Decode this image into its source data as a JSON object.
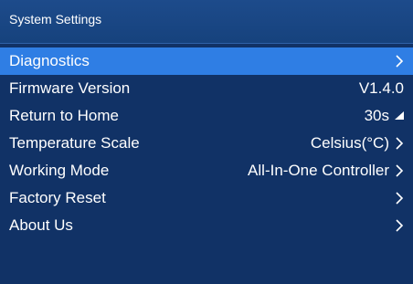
{
  "window": {
    "title": "System Settings"
  },
  "menu": {
    "items": [
      {
        "name": "diagnostics",
        "label": "Diagnostics",
        "value": "",
        "icon": "chevron-right-icon",
        "selected": true
      },
      {
        "name": "firmware-version",
        "label": "Firmware Version",
        "value": "V1.4.0",
        "icon": "",
        "selected": false
      },
      {
        "name": "return-to-home",
        "label": "Return to Home",
        "value": "30s",
        "icon": "triangle-corner-icon",
        "selected": false
      },
      {
        "name": "temperature-scale",
        "label": "Temperature Scale",
        "value": "Celsius(°C)",
        "icon": "chevron-right-icon",
        "selected": false
      },
      {
        "name": "working-mode",
        "label": "Working Mode",
        "value": "All-In-One Controller",
        "icon": "chevron-right-icon",
        "selected": false
      },
      {
        "name": "factory-reset",
        "label": "Factory Reset",
        "value": "",
        "icon": "chevron-right-icon",
        "selected": false
      },
      {
        "name": "about-us",
        "label": "About Us",
        "value": "",
        "icon": "chevron-right-icon",
        "selected": false
      }
    ]
  },
  "colors": {
    "background": "#113266",
    "title_bar": "#1a4784",
    "selection": "#2f7ee4",
    "text": "#ffffff"
  }
}
